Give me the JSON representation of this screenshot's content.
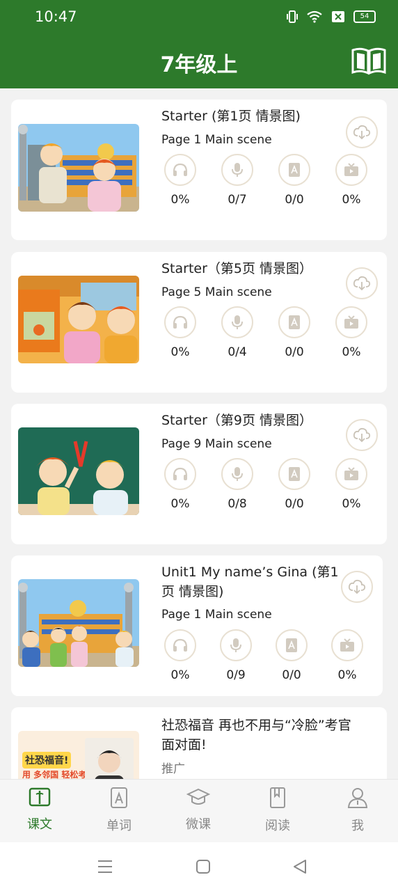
{
  "status": {
    "time": "10:47",
    "battery": "54"
  },
  "header": {
    "title": "7年级上"
  },
  "lessons": [
    {
      "title": "Starter (第1页 情景图)",
      "subtitle": "Page 1 Main scene",
      "stats": [
        "0%",
        "0/7",
        "0/0",
        "0%"
      ]
    },
    {
      "title": "Starter（第5页 情景图）",
      "subtitle": "Page 5 Main scene",
      "stats": [
        "0%",
        "0/4",
        "0/0",
        "0%"
      ]
    },
    {
      "title": "Starter（第9页 情景图）",
      "subtitle": "Page 9 Main scene",
      "stats": [
        "0%",
        "0/8",
        "0/0",
        "0%"
      ]
    },
    {
      "title_line1": "Unit1 My name’s Gina (第1",
      "title_line2": "页 情景图)",
      "subtitle": "Page 1 Main scene",
      "stats": [
        "0%",
        "0/9",
        "0/0",
        "0%"
      ]
    }
  ],
  "ad": {
    "title": "社恐福音 再也不用与“冷脸”考官面对面!",
    "tag": "推广",
    "image_text_1": "社恐福音!",
    "image_text_2": "用 多邻国 轻松考口语"
  },
  "tabs": [
    {
      "label": "课文",
      "icon": "book-icon"
    },
    {
      "label": "单词",
      "icon": "word-card-icon"
    },
    {
      "label": "微课",
      "icon": "graduation-cap-icon"
    },
    {
      "label": "阅读",
      "icon": "bookmark-book-icon"
    },
    {
      "label": "我",
      "icon": "person-icon"
    }
  ],
  "colors": {
    "primary": "#2d7a2b",
    "icon_border": "#e8e0d2",
    "icon_tint": "#c9c2b6"
  }
}
